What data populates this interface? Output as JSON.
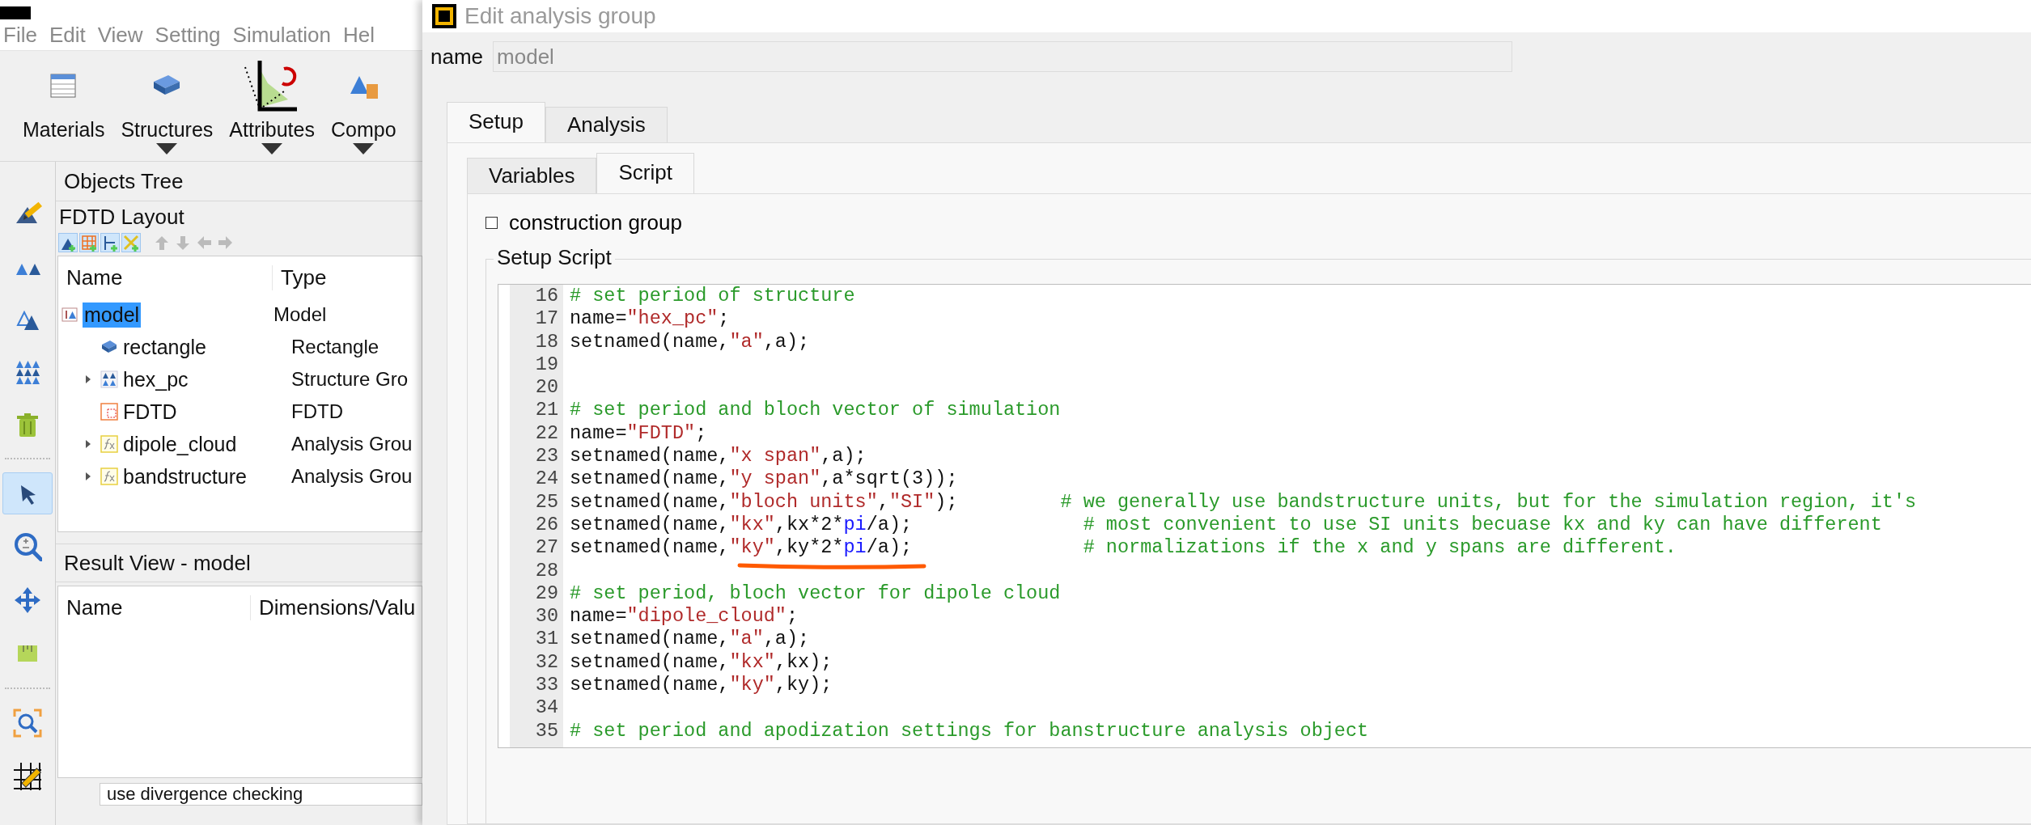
{
  "app": {
    "menu": [
      {
        "label": "File"
      },
      {
        "label": "Edit"
      },
      {
        "label": "View"
      },
      {
        "label": "Setting"
      },
      {
        "label": "Simulation"
      },
      {
        "label": "Hel"
      }
    ],
    "toolbar": [
      {
        "label": "Materials",
        "dropdown": false
      },
      {
        "label": "Structures",
        "dropdown": true
      },
      {
        "label": "Attributes",
        "dropdown": true
      },
      {
        "label": "Compo",
        "dropdown": true
      }
    ],
    "side_tools": [
      {
        "selected": false
      },
      {
        "selected": false
      },
      {
        "selected": false
      },
      {
        "selected": false
      },
      {
        "selected": false
      },
      {
        "selected": true
      },
      {
        "selected": false
      },
      {
        "selected": false
      },
      {
        "selected": false
      },
      {
        "selected": false
      },
      {
        "selected": false
      }
    ],
    "objects_tree": {
      "title": "Objects Tree",
      "subtitle": "FDTD Layout",
      "tools": [
        {
          "disabled": false
        },
        {
          "disabled": false
        },
        {
          "disabled": false
        },
        {
          "disabled": false
        },
        {
          "disabled": true
        },
        {
          "disabled": true
        },
        {
          "disabled": true
        },
        {
          "disabled": true
        }
      ],
      "columns": [
        "Name",
        "Type"
      ],
      "rows": [
        {
          "name": "model",
          "type": "Model",
          "kind": "model",
          "selected": true,
          "children": [
            {
              "name": "rectangle",
              "type": "Rectangle",
              "kind": "rectangle",
              "selected": false
            },
            {
              "name": "hex_pc",
              "type": "Structure Gro",
              "kind": "structure_group",
              "selected": false,
              "expanded": false
            },
            {
              "name": "FDTD",
              "type": "FDTD",
              "kind": "fdtd",
              "selected": false
            },
            {
              "name": "dipole_cloud",
              "type": "Analysis Grou",
              "kind": "analysis_group",
              "selected": false,
              "expanded": false
            },
            {
              "name": "bandstructure",
              "type": "Analysis Grou",
              "kind": "analysis_group",
              "selected": false,
              "expanded": false
            }
          ]
        }
      ]
    },
    "result_view": {
      "title": "Result View - model",
      "columns": [
        "Name",
        "Dimensions/Valu"
      ]
    },
    "bottom_field": {
      "value": "use divergence checking"
    }
  },
  "dialog": {
    "title": "Edit analysis group",
    "name_label": "name",
    "name_value": "model",
    "tabs": [
      {
        "label": "Setup",
        "selected": true
      },
      {
        "label": "Analysis",
        "selected": false
      }
    ],
    "subtabs": [
      {
        "label": "Variables",
        "selected": false
      },
      {
        "label": "Script",
        "selected": true
      }
    ],
    "checkbox": {
      "label": "construction group",
      "checked": false
    },
    "group_title": "Setup Script",
    "code_lines": [
      {
        "number": "16",
        "tokens": [
          {
            "kind": "comment",
            "text": "# set period of structure"
          }
        ]
      },
      {
        "number": "17",
        "tokens": [
          {
            "kind": "plain",
            "text": "name="
          },
          {
            "kind": "string",
            "text": "\"hex_pc\""
          },
          {
            "kind": "plain",
            "text": ";"
          }
        ]
      },
      {
        "number": "18",
        "tokens": [
          {
            "kind": "plain",
            "text": "setnamed(name,"
          },
          {
            "kind": "string",
            "text": "\"a\""
          },
          {
            "kind": "plain",
            "text": ",a);"
          }
        ]
      },
      {
        "number": "19"
      },
      {
        "number": "20"
      },
      {
        "number": "21",
        "tokens": [
          {
            "kind": "comment",
            "text": "# set period and bloch vector of simulation"
          }
        ]
      },
      {
        "number": "22",
        "tokens": [
          {
            "kind": "plain",
            "text": "name="
          },
          {
            "kind": "string",
            "text": "\"FDTD\""
          },
          {
            "kind": "plain",
            "text": ";"
          }
        ]
      },
      {
        "number": "23",
        "tokens": [
          {
            "kind": "plain",
            "text": "setnamed(name,"
          },
          {
            "kind": "string",
            "text": "\"x span\""
          },
          {
            "kind": "plain",
            "text": ",a);"
          }
        ]
      },
      {
        "number": "24",
        "tokens": [
          {
            "kind": "plain",
            "text": "setnamed(name,"
          },
          {
            "kind": "string",
            "text": "\"y span\""
          },
          {
            "kind": "plain",
            "text": ",a*sqrt(3));"
          }
        ]
      },
      {
        "number": "25",
        "tokens": [
          {
            "kind": "plain",
            "text": "setnamed(name,"
          },
          {
            "kind": "string",
            "text": "\"bloch units\""
          },
          {
            "kind": "plain",
            "text": ","
          },
          {
            "kind": "string",
            "text": "\"SI\""
          },
          {
            "kind": "plain",
            "text": ");         "
          },
          {
            "kind": "comment",
            "text": "# we generally use bandstructure units, but for the simulation region, it's"
          }
        ]
      },
      {
        "number": "26",
        "tokens": [
          {
            "kind": "plain",
            "text": "setnamed(name,"
          },
          {
            "kind": "string",
            "text": "\"kx\""
          },
          {
            "kind": "plain",
            "text": ",kx*2*"
          },
          {
            "kind": "builtin",
            "text": "pi"
          },
          {
            "kind": "plain",
            "text": "/a);               "
          },
          {
            "kind": "comment",
            "text": "# most convenient to use SI units becuase kx and ky can have different"
          }
        ]
      },
      {
        "number": "27",
        "tokens": [
          {
            "kind": "plain",
            "text": "setnamed(name,"
          },
          {
            "kind": "string",
            "text": "\"ky\""
          },
          {
            "kind": "plain",
            "text": ",ky*2*"
          },
          {
            "kind": "builtin",
            "text": "pi"
          },
          {
            "kind": "plain",
            "text": "/a);               "
          },
          {
            "kind": "comment",
            "text": "# normalizations if the x and y spans are different."
          }
        ]
      },
      {
        "number": "28"
      },
      {
        "number": "29",
        "tokens": [
          {
            "kind": "comment",
            "text": "# set period, bloch vector for dipole cloud"
          }
        ]
      },
      {
        "number": "30",
        "tokens": [
          {
            "kind": "plain",
            "text": "name="
          },
          {
            "kind": "string",
            "text": "\"dipole_cloud\""
          },
          {
            "kind": "plain",
            "text": ";"
          }
        ]
      },
      {
        "number": "31",
        "tokens": [
          {
            "kind": "plain",
            "text": "setnamed(name,"
          },
          {
            "kind": "string",
            "text": "\"a\""
          },
          {
            "kind": "plain",
            "text": ",a);"
          }
        ]
      },
      {
        "number": "32",
        "tokens": [
          {
            "kind": "plain",
            "text": "setnamed(name,"
          },
          {
            "kind": "string",
            "text": "\"kx\""
          },
          {
            "kind": "plain",
            "text": ",kx);"
          }
        ]
      },
      {
        "number": "33",
        "tokens": [
          {
            "kind": "plain",
            "text": "setnamed(name,"
          },
          {
            "kind": "string",
            "text": "\"ky\""
          },
          {
            "kind": "plain",
            "text": ",ky);"
          }
        ]
      },
      {
        "number": "34"
      },
      {
        "number": "35",
        "tokens": [
          {
            "kind": "comment",
            "text": "# set period and apodization settings for banstructure analysis object"
          }
        ]
      }
    ]
  }
}
